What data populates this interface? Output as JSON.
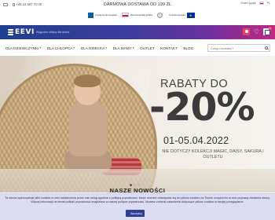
{
  "topbar": {
    "email": "",
    "phone": "+48 22 607 70 00",
    "promo": "DARMOWA DOSTAWA OD 199 ZŁ",
    "right_text": "Zmień język",
    "language": "PL"
  },
  "funding": {
    "logo1": "Fundusze Europejskie",
    "logo2": "Rzeczpospolita Polska",
    "logo3": "",
    "logo4": "Unia Europejska"
  },
  "header": {
    "brand": "EEVI",
    "tagline": "Wygodne sklepy dla dzieci",
    "cart_count": "0"
  },
  "nav": {
    "items": [
      {
        "label": "DLA DZIEWCZYNKI",
        "caret": true
      },
      {
        "label": "DLA CHŁOPCA",
        "caret": true
      },
      {
        "label": "DLA DZIECKA",
        "caret": true
      },
      {
        "label": "DLA MAMY",
        "caret": true
      },
      {
        "label": "OUTLET",
        "caret": false
      },
      {
        "label": "KONTAKT",
        "caret": false
      },
      {
        "label": "BLOG",
        "caret": false
      }
    ],
    "search_placeholder": "Czego szukasz?"
  },
  "hero": {
    "headline": "RABATY DO",
    "discount": "-20%",
    "dates": "01-05.04.2022",
    "note": "Nie dotyczy kolekcji MAGIC, DAISY, SAKURA i OUTLETU"
  },
  "section": {
    "title": "NASZE NOWOŚCI"
  },
  "cookie": {
    "text": "Ta strona wykorzystuje pliki cookies w celu świadczenia przez nas usług zgodnie z polityką prywatności. Może również odwoływać się do plików cookies na Twoim urządzeniu w celu poprawy działania strony. Więcej informacji na temat polityki prywatności znajdziesz w naszej polityce prywatności. Możesz zmienić ustawienia dotyczące plików cookies w swojej przeglądarce.",
    "button": "Akceptuj"
  },
  "colors": {
    "header_start": "#1f3f8f",
    "header_end": "#c02a84",
    "accent_red": "#e2465f",
    "cookie_bg": "#dcdcf5",
    "button_bg": "#2c3e8f"
  }
}
